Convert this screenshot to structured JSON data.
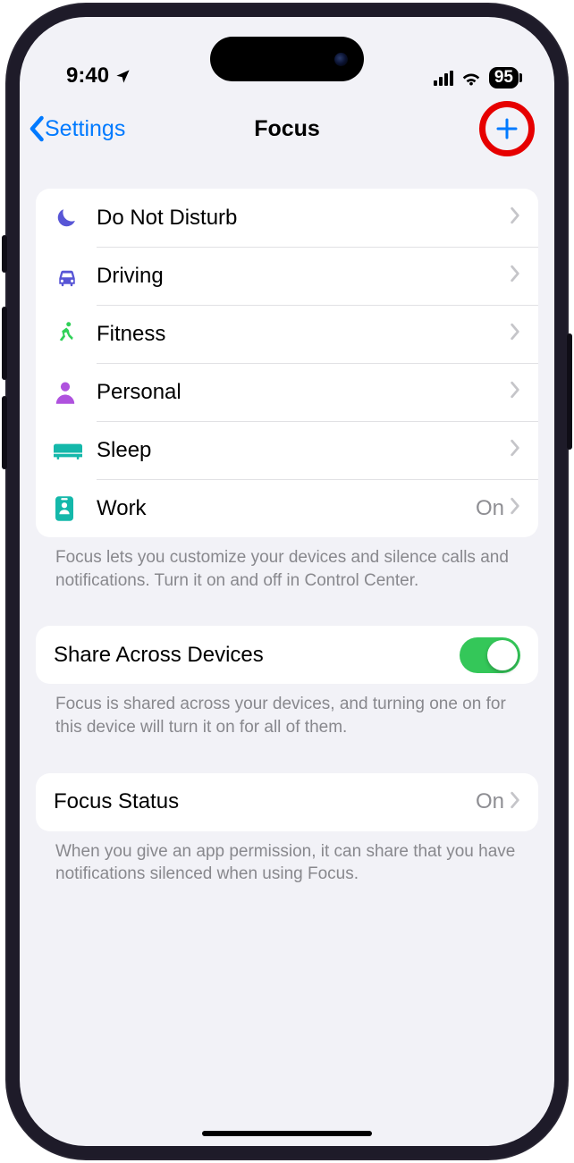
{
  "status": {
    "time": "9:40",
    "battery": "95"
  },
  "nav": {
    "back": "Settings",
    "title": "Focus"
  },
  "focusModes": [
    {
      "label": "Do Not Disturb",
      "icon": "moon",
      "color": "#5856d6"
    },
    {
      "label": "Driving",
      "icon": "car",
      "color": "#5856d6"
    },
    {
      "label": "Fitness",
      "icon": "runner",
      "color": "#30d158"
    },
    {
      "label": "Personal",
      "icon": "person",
      "color": "#af52de"
    },
    {
      "label": "Sleep",
      "icon": "bed",
      "color": "#14b8aa"
    },
    {
      "label": "Work",
      "icon": "badge",
      "color": "#14b8aa",
      "value": "On"
    }
  ],
  "footer1": "Focus lets you customize your devices and silence calls and notifications. Turn it on and off in Control Center.",
  "share": {
    "label": "Share Across Devices",
    "on": true
  },
  "footer2": "Focus is shared across your devices, and turning one on for this device will turn it on for all of them.",
  "status_row": {
    "label": "Focus Status",
    "value": "On"
  },
  "footer3": "When you give an app permission, it can share that you have notifications silenced when using Focus."
}
